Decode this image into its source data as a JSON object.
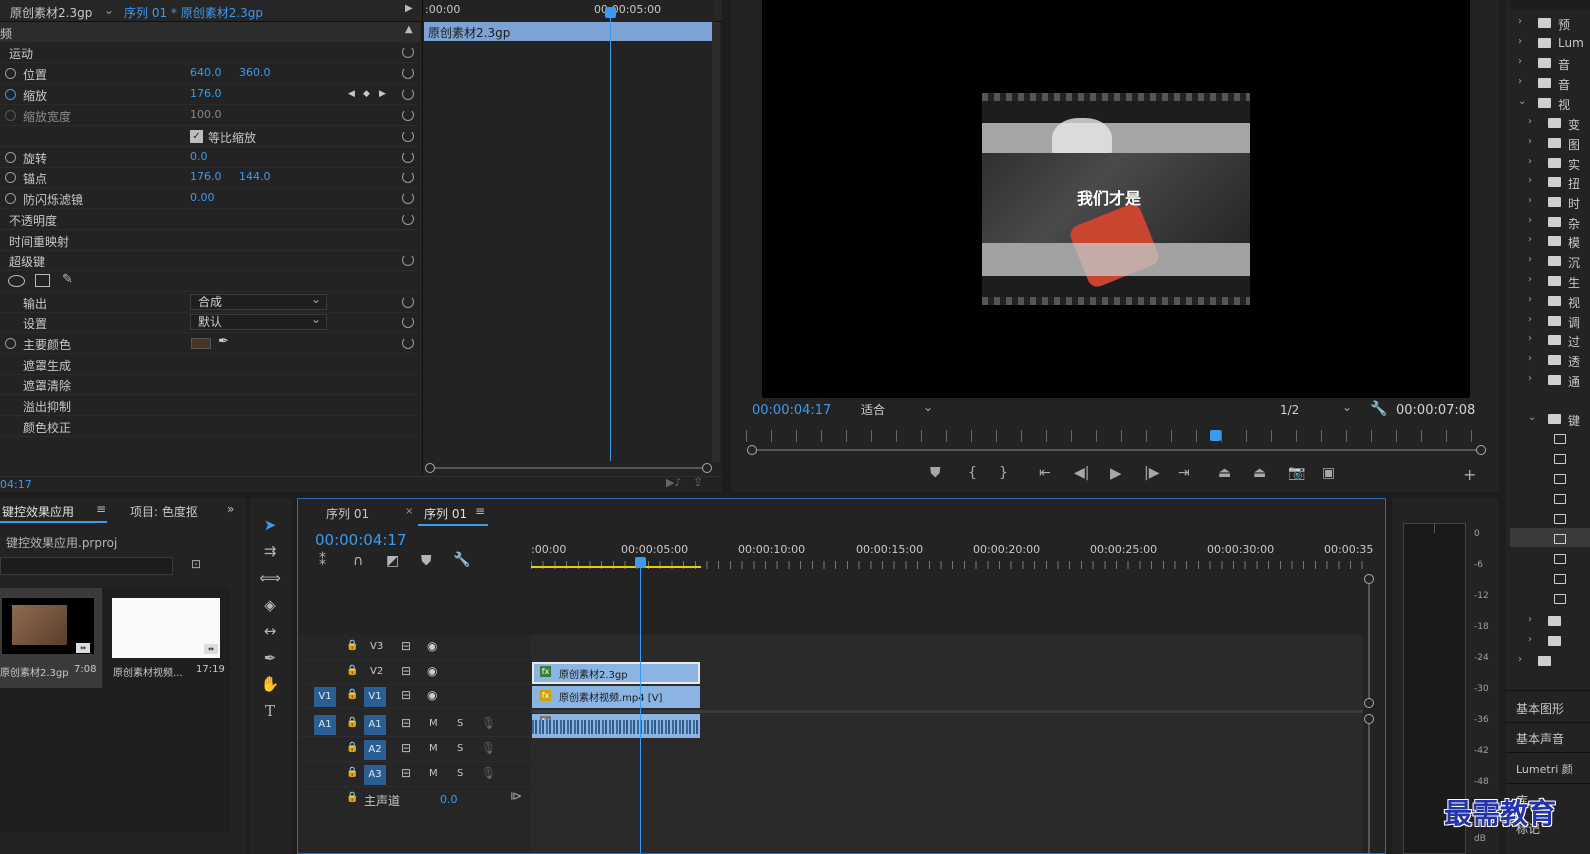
{
  "effect_controls": {
    "source_tab": "原创素材2.3gp",
    "seq_tab": "序列 01 * 原创素材2.3gp",
    "header_left": "频",
    "mini_time_start": ":00:00",
    "mini_time_mid": "00:00:05:00",
    "clip_name": "原创素材2.3gp",
    "current_time": "04:17",
    "rows": {
      "motion": "运动",
      "position": "位置",
      "position_x": "640.0",
      "position_y": "360.0",
      "scale": "缩放",
      "scale_val": "176.0",
      "scale_width": "缩放宽度",
      "scale_width_val": "100.0",
      "uniform_scale": "等比缩放",
      "rotation": "旋转",
      "rotation_val": "0.0",
      "anchor": "锚点",
      "anchor_x": "176.0",
      "anchor_y": "144.0",
      "anti_flicker": "防闪烁滤镜",
      "anti_flicker_val": "0.00",
      "opacity": "不透明度",
      "time_remap": "时间重映射",
      "ultra_key": "超级键",
      "output": "输出",
      "output_val": "合成",
      "settings": "设置",
      "settings_val": "默认",
      "key_color": "主要颜色",
      "matte_gen": "遮罩生成",
      "matte_clean": "遮罩清除",
      "spill": "溢出抑制",
      "color_correct": "颜色校正"
    }
  },
  "program": {
    "timecode": "00:00:04:17",
    "fit": "适合",
    "resolution": "1/2",
    "duration": "00:00:07:08",
    "overlay_text": "我们才是"
  },
  "project": {
    "tab_active": "键控效果应用",
    "tab_other": "项目: 色度抠",
    "filename": "键控效果应用.prproj",
    "items": [
      {
        "name": "原创素材2.3gp",
        "duration": "7:08"
      },
      {
        "name": "原创素材视频...",
        "duration": "17:19"
      }
    ]
  },
  "timeline": {
    "tab1": "序列 01",
    "tab2": "序列 01",
    "timecode": "00:00:04:17",
    "ruler": [
      ":00:00",
      "00:00:05:00",
      "00:00:10:00",
      "00:00:15:00",
      "00:00:20:00",
      "00:00:25:00",
      "00:00:30:00",
      "00:00:35"
    ],
    "tracks_v": [
      "V3",
      "V2",
      "V1"
    ],
    "tracks_a": [
      "A1",
      "A2",
      "A3"
    ],
    "src_v": "V1",
    "src_a": "A1",
    "master": "主声道",
    "master_val": "0.0",
    "clip_v2": "原创素材2.3gp",
    "clip_v1": "原创素材视频.mp4 [V]",
    "m": "M",
    "s": "S"
  },
  "meter": {
    "ticks": [
      "0",
      "-6",
      "-12",
      "-18",
      "-24",
      "-30",
      "-36",
      "-42",
      "-48",
      "-54",
      "dB"
    ]
  },
  "right_panel": {
    "folders": [
      "预",
      "Lum",
      "音",
      "音",
      "视",
      "变",
      "图",
      "实",
      "扭",
      "时",
      "杂",
      "模",
      "沉",
      "生",
      "视",
      "调",
      "过",
      "透",
      "通",
      "键"
    ],
    "bottom": [
      "基本图形",
      "基本声音",
      "Lumetri 颜",
      "库",
      "标记"
    ]
  },
  "watermark": "最需教育"
}
